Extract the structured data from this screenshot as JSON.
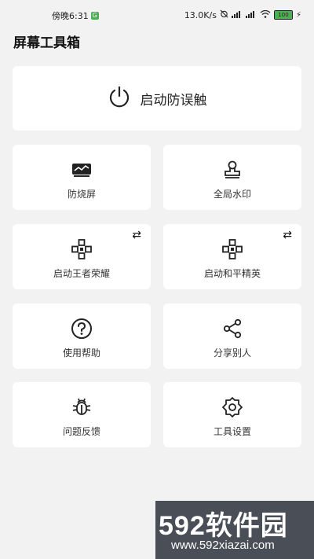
{
  "status": {
    "time": "傍晚6:31",
    "time_badge": "G",
    "speed": "13.0K/s",
    "battery": "100",
    "battery_level": 1.0
  },
  "app": {
    "title": "屏幕工具箱"
  },
  "main_button": {
    "label": "启动防误触",
    "icon": "power-icon"
  },
  "tiles": [
    {
      "label": "防烧屏",
      "icon": "screen-wave-icon"
    },
    {
      "label": "全局水印",
      "icon": "stamp-icon"
    },
    {
      "label": "启动王者荣耀",
      "icon": "gamepad-icon",
      "swap": "⇄"
    },
    {
      "label": "启动和平精英",
      "icon": "gamepad-icon",
      "swap": "⇄"
    },
    {
      "label": "使用帮助",
      "icon": "help-icon"
    },
    {
      "label": "分享别人",
      "icon": "share-icon"
    },
    {
      "label": "问题反馈",
      "icon": "bug-icon"
    },
    {
      "label": "工具设置",
      "icon": "gear-icon"
    }
  ],
  "watermark": {
    "title": "592软件园",
    "url": "www.592xiazai.com"
  },
  "colors": {
    "background": "#f2f2f2",
    "card": "#ffffff",
    "watermark_bg": "#4a4f57"
  }
}
